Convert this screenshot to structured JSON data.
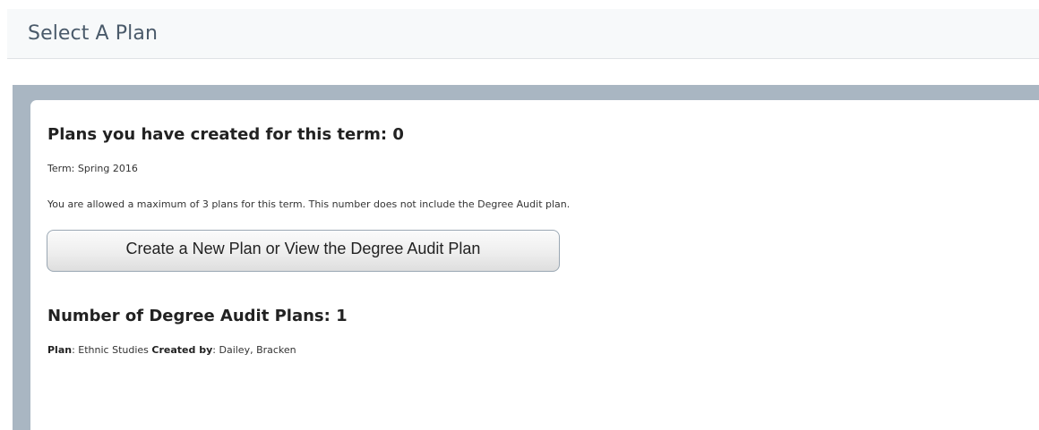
{
  "header": {
    "title": "Select A Plan"
  },
  "plans_section": {
    "heading": "Plans you have created for this term: 0",
    "term": "Term: Spring 2016",
    "allowed_note": "You are allowed a maximum of 3 plans for this term. This number does not include the Degree Audit plan.",
    "create_button_label": "Create a New Plan or View the Degree Audit Plan"
  },
  "degree_audit_section": {
    "heading": "Number of Degree Audit Plans: 1",
    "plan_label": "Plan",
    "plan_value": "Ethnic Studies",
    "created_by_label": "Created by",
    "created_by_value": "Dailey, Bracken"
  },
  "colors": {
    "header_bg": "#f7f9fa",
    "title_text": "#4a5a6a",
    "panel_bg": "#a9b6c2",
    "card_bg": "#ffffff"
  }
}
